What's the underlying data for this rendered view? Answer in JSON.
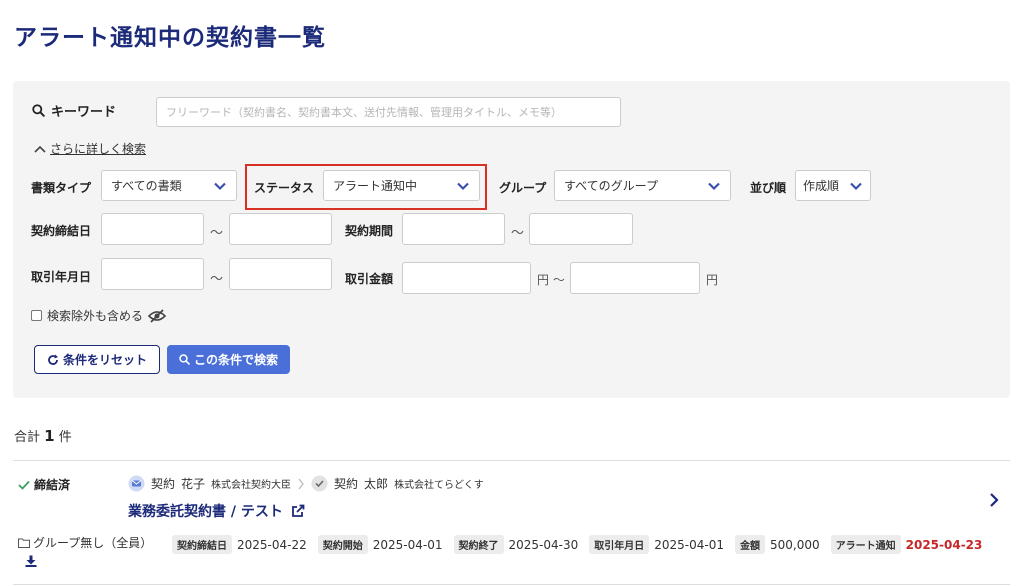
{
  "page": {
    "title": "アラート通知中の契約書一覧"
  },
  "search": {
    "keyword_label": "キーワード",
    "keyword_placeholder": "フリーワード（契約書名、契約書本文、送付先情報、管理用タイトル、メモ等）",
    "keyword_value": "",
    "detail_toggle": "さらに詳しく検索",
    "doc_type": {
      "label": "書類タイプ",
      "value": "すべての書類"
    },
    "status": {
      "label": "ステータス",
      "value": "アラート通知中"
    },
    "group": {
      "label": "グループ",
      "value": "すべてのグループ"
    },
    "sort": {
      "label": "並び順",
      "value": "作成順"
    },
    "contract_date": {
      "label": "契約締結日",
      "sep": "〜"
    },
    "contract_period": {
      "label": "契約期間",
      "sep": "〜"
    },
    "trade_date": {
      "label": "取引年月日",
      "sep": "〜"
    },
    "amount": {
      "label": "取引金額",
      "unit_mid": "円 〜",
      "unit_end": "円"
    },
    "include_excluded": {
      "label": "検索除外も含める",
      "checked": false
    },
    "reset_button": "条件をリセット",
    "search_button": "この条件で検索"
  },
  "results": {
    "total_prefix": "合計",
    "total_count": "1",
    "total_suffix": "件",
    "items": [
      {
        "status": "締結済",
        "sender": {
          "name1": "契約",
          "name2": "花子",
          "company": "株式会社契約大臣"
        },
        "receiver": {
          "name1": "契約",
          "name2": "太郎",
          "company": "株式会社てらどくす"
        },
        "title": "業務委託契約書 / テスト",
        "group": "グループ無し（全員）",
        "meta": {
          "signed_label": "契約締結日",
          "signed": "2025-04-22",
          "start_label": "契約開始",
          "start": "2025-04-01",
          "end_label": "契約終了",
          "end": "2025-04-30",
          "trade_label": "取引年月日",
          "trade": "2025-04-01",
          "amount_label": "金額",
          "amount": "500,000",
          "alert_label": "アラート通知",
          "alert": "2025-04-23"
        }
      }
    ]
  },
  "colors": {
    "accent": "#1c2a7a",
    "button": "#4a6fd8",
    "highlight": "#d93025",
    "alert": "#c62828"
  }
}
